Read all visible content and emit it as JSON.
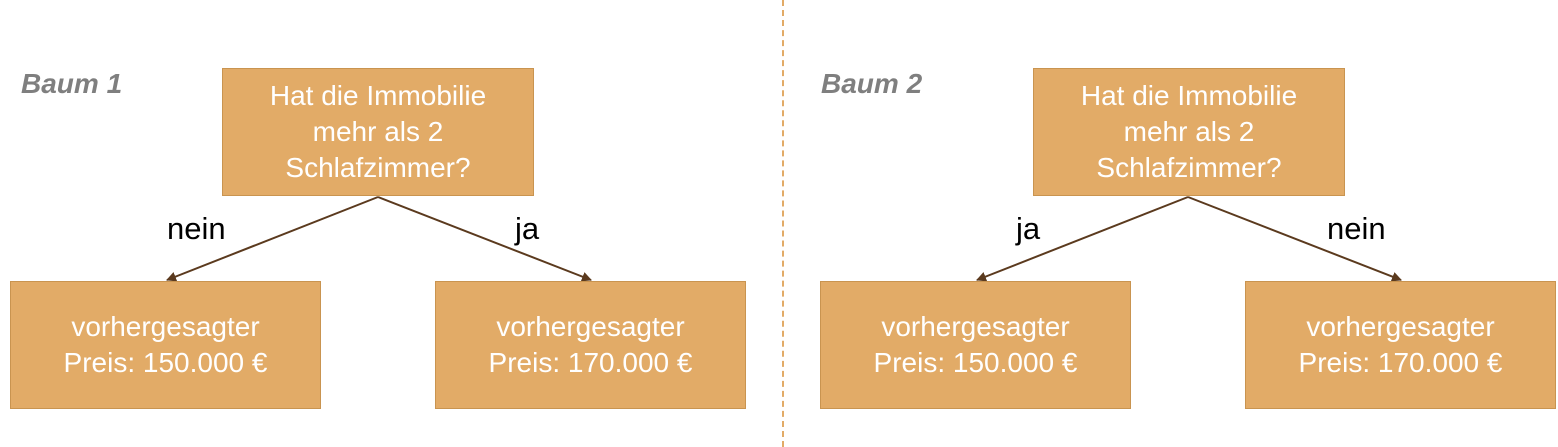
{
  "colors": {
    "node_fill": "#e2ab67",
    "edge": "#5b3a1e",
    "title": "#7f7f7f",
    "divider": "#e2ab67"
  },
  "trees": [
    {
      "title": "Baum 1",
      "question": "Hat die Immobilie\nmehr als 2\nSchlafzimmer?",
      "left_edge_label": "nein",
      "right_edge_label": "ja",
      "left_leaf": "vorhergesagter\nPreis: 150.000 €",
      "right_leaf": "vorhergesagter\nPreis: 170.000 €"
    },
    {
      "title": "Baum 2",
      "question": "Hat die Immobilie\nmehr als 2\nSchlafzimmer?",
      "left_edge_label": "ja",
      "right_edge_label": "nein",
      "left_leaf": "vorhergesagter\nPreis: 150.000 €",
      "right_leaf": "vorhergesagter\nPreis: 170.000 €"
    }
  ]
}
